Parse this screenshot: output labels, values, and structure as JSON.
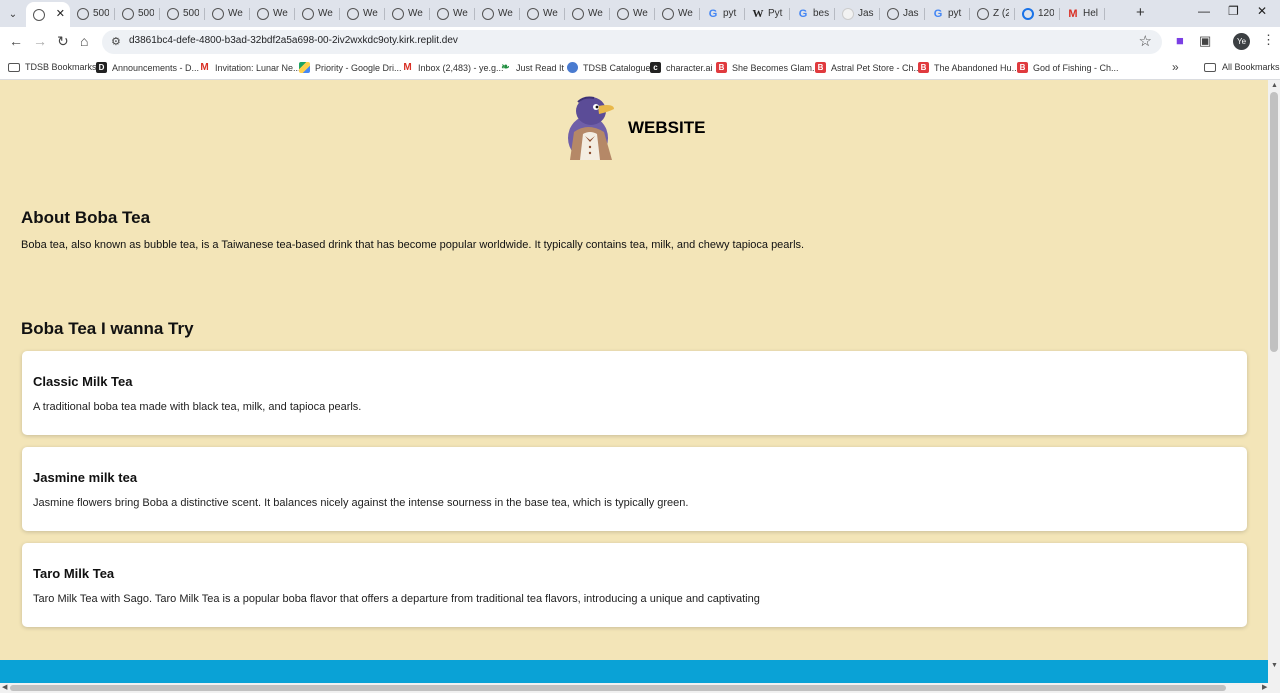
{
  "browser": {
    "tabs": [
      {
        "title": "",
        "icon": "globe-icon",
        "active": true
      },
      {
        "title": "500",
        "icon": "globe-icon"
      },
      {
        "title": "500",
        "icon": "globe-icon"
      },
      {
        "title": "500",
        "icon": "globe-icon"
      },
      {
        "title": "We",
        "icon": "globe-icon"
      },
      {
        "title": "We",
        "icon": "globe-icon"
      },
      {
        "title": "We",
        "icon": "globe-icon"
      },
      {
        "title": "We",
        "icon": "globe-icon"
      },
      {
        "title": "We",
        "icon": "globe-icon"
      },
      {
        "title": "We",
        "icon": "globe-icon"
      },
      {
        "title": "We",
        "icon": "globe-icon"
      },
      {
        "title": "We",
        "icon": "globe-icon"
      },
      {
        "title": "We",
        "icon": "globe-icon"
      },
      {
        "title": "We",
        "icon": "globe-icon"
      },
      {
        "title": "We",
        "icon": "globe-icon"
      },
      {
        "title": "pyt",
        "icon": "google-icon"
      },
      {
        "title": "Pyt",
        "icon": "wikipedia-icon"
      },
      {
        "title": "bes",
        "icon": "google-icon"
      },
      {
        "title": "Jas",
        "icon": "blank-page-icon"
      },
      {
        "title": "Jas",
        "icon": "globe-icon"
      },
      {
        "title": "pyt",
        "icon": "google-icon"
      },
      {
        "title": "Z (2",
        "icon": "globe-icon"
      },
      {
        "title": "120",
        "icon": "ring-icon"
      },
      {
        "title": "Hel",
        "icon": "gmail-icon"
      }
    ],
    "url": "d3861bc4-defe-4800-b3ad-32bdf2a5a698-00-2iv2wxkdc9oty.kirk.replit.dev",
    "profile_initials": "Ye",
    "bookmarks": [
      {
        "label": "TDSB Bookmarks",
        "icon": "folder-icon"
      },
      {
        "label": "Announcements - D...",
        "icon": "dsb-icon"
      },
      {
        "label": "Invitation: Lunar Ne...",
        "icon": "gmail-icon"
      },
      {
        "label": "Priority - Google Dri...",
        "icon": "google-drive-icon"
      },
      {
        "label": "Inbox (2,483) - ye.g...",
        "icon": "gmail-icon"
      },
      {
        "label": "Just Read It",
        "icon": "leaf-icon"
      },
      {
        "label": "TDSB Catalogue",
        "icon": "catalogue-icon"
      },
      {
        "label": "character.ai",
        "icon": "character-ai-icon"
      },
      {
        "label": "She Becomes Glam...",
        "icon": "b-icon"
      },
      {
        "label": "Astral Pet Store - Ch...",
        "icon": "b-icon"
      },
      {
        "label": "The Abandoned Hu...",
        "icon": "b-icon"
      },
      {
        "label": "God of Fishing - Ch...",
        "icon": "b-icon"
      }
    ],
    "all_bookmarks_label": "All Bookmarks"
  },
  "page": {
    "site_title": "WEBSITE",
    "about": {
      "heading": "About Boba Tea",
      "text": "Boba tea, also known as bubble tea, is a Taiwanese tea-based drink that has become popular worldwide. It typically contains tea, milk, and chewy tapioca pearls."
    },
    "list_heading": "Boba Tea I wanna Try",
    "items": [
      {
        "name": "Classic Milk Tea",
        "description": "A traditional boba tea made with black tea, milk, and tapioca pearls."
      },
      {
        "name": "Jasmine milk tea",
        "description": "Jasmine flowers bring Boba a distinctive scent. It balances nicely against the intense sourness in the base tea, which is typically green."
      },
      {
        "name": "Taro Milk Tea",
        "description": "Taro Milk Tea with Sago. Taro Milk Tea is a popular boba flavor that offers a departure from traditional tea flavors, introducing a unique and captivating"
      }
    ]
  },
  "colors": {
    "page_background": "#f3e5b8",
    "footer": "#0aa2d6",
    "card": "#ffffff"
  }
}
